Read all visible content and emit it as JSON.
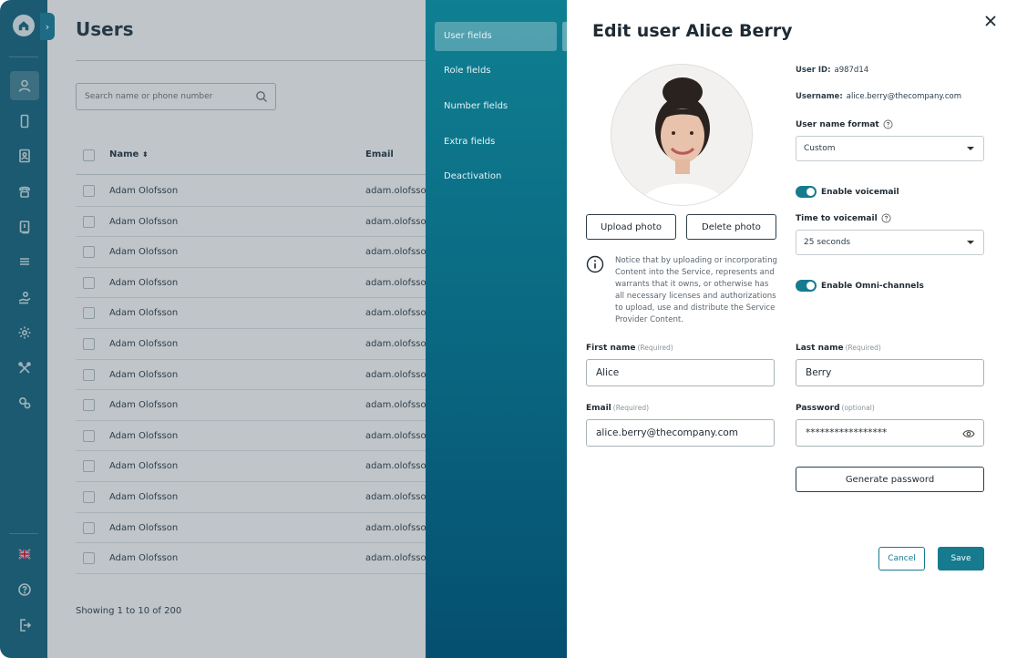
{
  "sidebar": {
    "icons": [
      "home-icon",
      "user-icon",
      "mobile-icon",
      "contact-card-icon",
      "phone-icon",
      "book-icon",
      "list-icon",
      "hand-icon",
      "gear-icon",
      "tools-icon",
      "gears-icon",
      "flag-icon",
      "help-icon",
      "logout-icon"
    ]
  },
  "users_page": {
    "title": "Users",
    "search_placeholder": "Search name or phone number",
    "columns": {
      "name": "Name",
      "email": "Email"
    },
    "sort_indicator": "⬍",
    "rows": [
      {
        "name": "Adam Olofsson",
        "email": "adam.olofsson"
      },
      {
        "name": "Adam Olofsson",
        "email": "adam.olofsson"
      },
      {
        "name": "Adam Olofsson",
        "email": "adam.olofsson"
      },
      {
        "name": "Adam Olofsson",
        "email": "adam.olofsson"
      },
      {
        "name": "Adam Olofsson",
        "email": "adam.olofsson"
      },
      {
        "name": "Adam Olofsson",
        "email": "adam.olofsson"
      },
      {
        "name": "Adam Olofsson",
        "email": "adam.olofsson"
      },
      {
        "name": "Adam Olofsson",
        "email": "adam.olofsson"
      },
      {
        "name": "Adam Olofsson",
        "email": "adam.olofsson"
      },
      {
        "name": "Adam Olofsson",
        "email": "adam.olofsson"
      },
      {
        "name": "Adam Olofsson",
        "email": "adam.olofsson"
      },
      {
        "name": "Adam Olofsson",
        "email": "adam.olofsson"
      },
      {
        "name": "Adam Olofsson",
        "email": "adam.olofsson"
      }
    ],
    "showing": "Showing 1 to 10 of 200"
  },
  "tabs": [
    {
      "label": "User fields",
      "active": true
    },
    {
      "label": "Role fields",
      "active": false
    },
    {
      "label": "Number fields",
      "active": false
    },
    {
      "label": "Extra fields",
      "active": false
    },
    {
      "label": "Deactivation",
      "active": false
    }
  ],
  "edit": {
    "title": "Edit user Alice Berry",
    "upload_photo": "Upload photo",
    "delete_photo": "Delete photo",
    "notice": "Notice that by uploading or incorporating Content into the Service, represents and warrants that it owns, or otherwise has all necessary licenses and authorizations to upload, use and distribute the Service Provider Content.",
    "user_id_label": "User ID:",
    "user_id": "a987d14",
    "username_label": "Username:",
    "username": "alice.berry@thecompany.com",
    "name_format_label": "User name format",
    "name_format_value": "Custom",
    "voicemail_label": "Enable voicemail",
    "voicemail_enabled": true,
    "time_voicemail_label": "Time to voicemail",
    "time_voicemail_value": "25 seconds",
    "omni_label": "Enable Omni-channels",
    "omni_enabled": true,
    "first_name_label": "First name",
    "last_name_label": "Last name",
    "required_hint": "(Required)",
    "optional_hint": "(optional)",
    "first_name": "Alice",
    "last_name": "Berry",
    "email_label": "Email",
    "email": "alice.berry@thecompany.com",
    "password_label": "Password",
    "password": "*****************",
    "generate_password": "Generate password",
    "cancel": "Cancel",
    "save": "Save"
  },
  "colors": {
    "rail": "#1d6b84",
    "accent": "#167b8e",
    "tabs_top": "#0f7f92",
    "tabs_bottom": "#054f70"
  }
}
